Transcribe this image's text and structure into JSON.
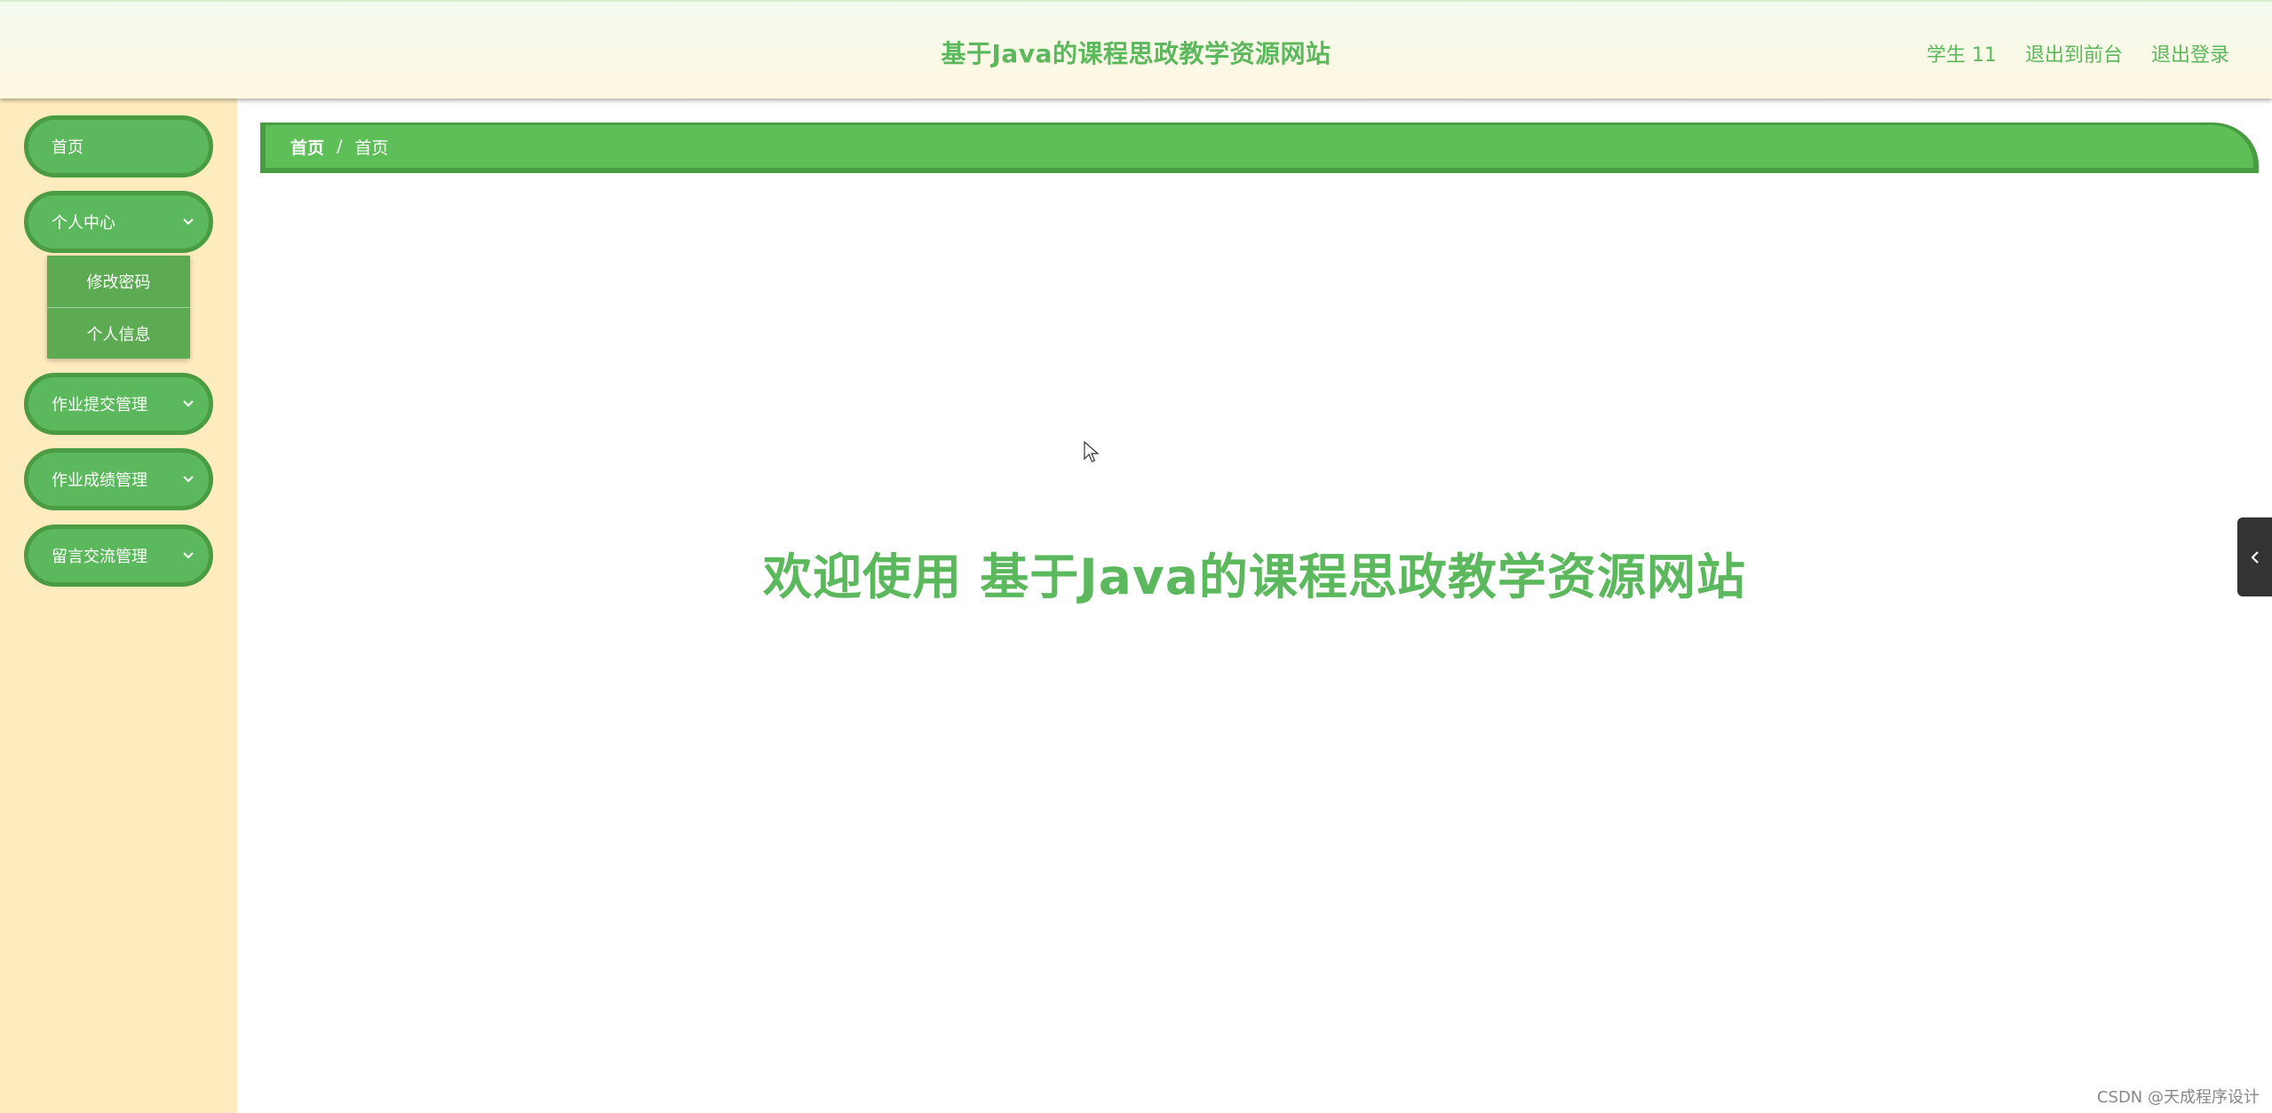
{
  "header": {
    "title": "基于Java的课程思政教学资源网站",
    "links": [
      "学生 11",
      "退出到前台",
      "退出登录"
    ]
  },
  "sidebar": {
    "items": [
      {
        "label": "首页"
      },
      {
        "label": "个人中心",
        "expanded": true,
        "children": [
          "修改密码",
          "个人信息"
        ]
      },
      {
        "label": "作业提交管理"
      },
      {
        "label": "作业成绩管理"
      },
      {
        "label": "留言交流管理"
      }
    ]
  },
  "breadcrumb": {
    "items": [
      "首页",
      "首页"
    ],
    "separator": "/"
  },
  "main": {
    "welcome": "欢迎使用 基于Java的课程思政教学资源网站"
  },
  "side_toggle": {
    "icon": "chevron-left-icon"
  },
  "watermark": "CSDN @天成程序设计",
  "colors": {
    "accent": "#5cb85c",
    "accent_dark": "#4a9c43",
    "sidebar_bg": "#ffecbe"
  },
  "icons": {
    "menu_expand": "chevron-down-icon",
    "cursor": "mouse-cursor-icon"
  }
}
